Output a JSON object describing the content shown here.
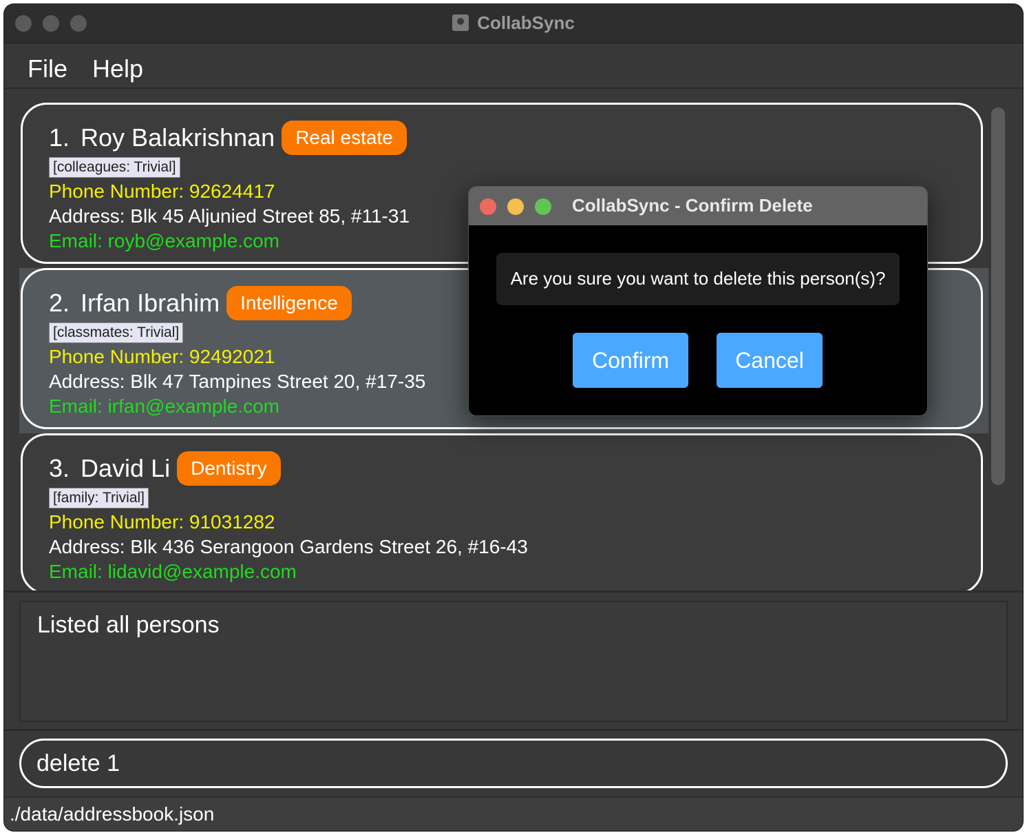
{
  "window": {
    "title": "CollabSync",
    "app_icon": "contact-book-icon",
    "traffic_light_color": "#5a5a5a"
  },
  "menu": [
    {
      "label": "File"
    },
    {
      "label": "Help"
    }
  ],
  "persons": [
    {
      "index": "1.",
      "name": "Roy Balakrishnan",
      "badge": "Real estate",
      "tag": "[colleagues: Trivial]",
      "phone": "Phone Number: 92624417",
      "address": "Address: Blk 45 Aljunied Street 85, #11-31",
      "email": "Email: royb@example.com"
    },
    {
      "index": "2.",
      "name": "Irfan Ibrahim",
      "badge": "Intelligence",
      "tag": "[classmates: Trivial]",
      "phone": "Phone Number: 92492021",
      "address": "Address: Blk 47 Tampines Street 20, #17-35",
      "email": "Email: irfan@example.com",
      "selected": true
    },
    {
      "index": "3.",
      "name": "David Li",
      "badge": "Dentistry",
      "tag": "[family: Trivial]",
      "phone": "Phone Number: 91031282",
      "address": "Address: Blk 436 Serangoon Gardens Street 26, #16-43",
      "email": "Email: lidavid@example.com"
    }
  ],
  "result_display": "Listed all persons",
  "command_box": {
    "value": "delete 1"
  },
  "status_bar": "./data/addressbook.json",
  "dialog": {
    "title": "CollabSync - Confirm Delete",
    "message": "Are you sure you want to delete this person(s)?",
    "confirm_label": "Confirm",
    "cancel_label": "Cancel"
  },
  "colors": {
    "badge": "#fb7800",
    "phone": "#f5f000",
    "email": "#1fdb1f",
    "dialog_button": "#4aa8ff",
    "close": "#ec6a5e",
    "minimize": "#f4bf4f",
    "maximize": "#61c554"
  }
}
